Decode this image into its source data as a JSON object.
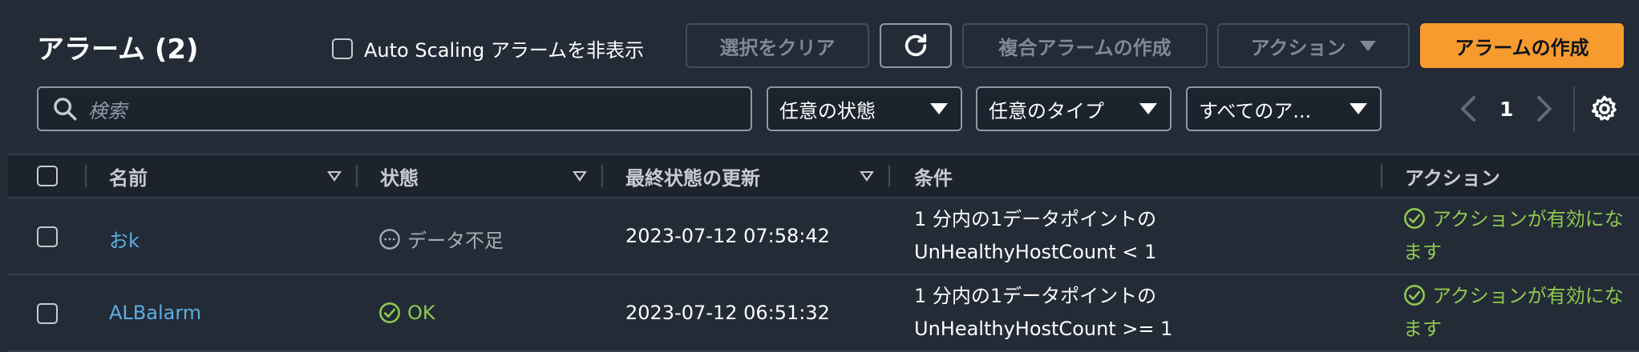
{
  "header": {
    "title": "アラーム (2)",
    "hide_autoscaling_label": "Auto Scaling アラームを非表示",
    "clear_selection_label": "選択をクリア",
    "composite_alarm_label": "複合アラームの作成",
    "actions_label": "アクション",
    "create_alarm_label": "アラームの作成"
  },
  "filters": {
    "search_placeholder": "検索",
    "state_value": "任意の状態",
    "type_value": "任意のタイプ",
    "alarms_value": "すべてのア..."
  },
  "pagination": {
    "current_page": "1"
  },
  "table": {
    "columns": [
      "名前",
      "状態",
      "最終状態の更新",
      "条件",
      "アクション"
    ],
    "rows": [
      {
        "name": "おk",
        "state": "データ不足",
        "updated": "2023-07-12 07:58:42",
        "condition_line1": "1 分内の1データポイントの",
        "condition_line2": "UnHealthyHostCount < 1",
        "actions_line1": "アクションが有効にな",
        "actions_line2": "ます"
      },
      {
        "name": "ALBalarm",
        "state": "OK",
        "updated": "2023-07-12 06:51:32",
        "condition_line1": "1 分内の1データポイントの",
        "condition_line2": "UnHealthyHostCount >= 1",
        "actions_line1": "アクションが有効にな",
        "actions_line2": "ます"
      }
    ]
  },
  "colors": {
    "background": "#232b37",
    "primary_button": "#f89b2f",
    "link": "#5dade2",
    "success": "#8fc94f",
    "muted": "#a6acb4"
  }
}
